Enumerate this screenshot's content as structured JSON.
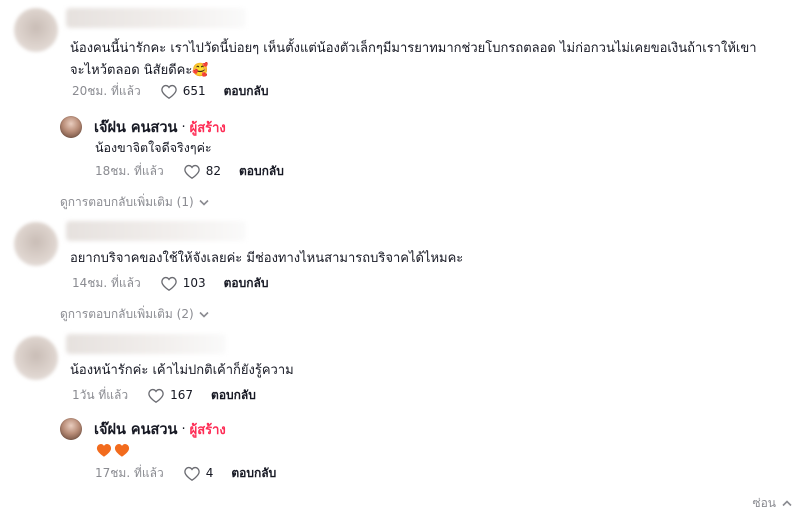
{
  "comments": [
    {
      "text": "น้องคนนี้น่ารักคะ เราไปวัดนี้บ่อยๆ เห็นตั้งแต่น้องตัวเล็กๆมีมารยาทมากช่วยโบกรถตลอด ไม่ก่อกวนไม่เคยขอเงินถ้าเราให้เขาจะไหว้ตลอด นิสัยดีคะ🥰",
      "time": "20ชม. ที่แล้ว",
      "likes": "651",
      "reply_label": "ตอบกลับ",
      "replies": [
        {
          "author": "เจ๊ฝน คนสวน",
          "badge": "ผู้สร้าง",
          "text": "น้องขาจิตใจดีจริงๆค่ะ",
          "time": "18ชม. ที่แล้ว",
          "likes": "82",
          "reply_label": "ตอบกลับ"
        }
      ],
      "more_replies": "ดูการตอบกลับเพิ่มเติม (1)"
    },
    {
      "text": "อยากบริจาคของใช้ให้จังเลยค่ะ มีช่องทางไหนสามารถบริจาคได้ไหมคะ",
      "time": "14ชม. ที่แล้ว",
      "likes": "103",
      "reply_label": "ตอบกลับ",
      "more_replies": "ดูการตอบกลับเพิ่มเติม (2)"
    },
    {
      "text": "น้องหน้ารักค่ะ เค้าไม่ปกติเค้าก็ยังรู้ความ",
      "time": "1วัน ที่แล้ว",
      "likes": "167",
      "reply_label": "ตอบกลับ",
      "replies": [
        {
          "author": "เจ๊ฝน คนสวน",
          "badge": "ผู้สร้าง",
          "text": "🧡🧡",
          "time": "17ชม. ที่แล้ว",
          "likes": "4",
          "reply_label": "ตอบกลับ"
        }
      ]
    }
  ],
  "hide_label": "ซ่อน",
  "colors": {
    "creator": "#fe2c55",
    "meta": "#8a8b91",
    "heart_emoji": "#f26b1d"
  },
  "icons": [
    "heart-outline-icon",
    "chevron-down-icon",
    "chevron-up-icon",
    "orange-heart-emoji"
  ]
}
